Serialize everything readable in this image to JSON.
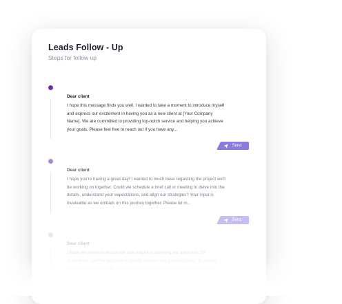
{
  "header": {
    "title": "Leads Follow - Up",
    "subtitle": "Steps for follow up"
  },
  "steps": [
    {
      "greeting": "Dear client",
      "body": "I hope this message finds you well. I wanted to take a moment to introduce myself and express our excitement in having you as a new client at [Your Company Name]. We are committed to providing top-notch service and helping you achieve your goals. Please feel free to reach out if you have any...",
      "send_label": "Send",
      "dot_color": "#6a2fa5",
      "button_color": "#8d7adf"
    },
    {
      "greeting": "Dear client",
      "body": "I hope you're having a great day! I wanted to touch base regarding the project we'll be working on together. Could we schedule a brief call or meeting to delve into the details, understand your expectations, and align our strategies? Your input is invaluable as we embark on this journey together. Please let m...",
      "send_label": "Send",
      "dot_color": "#a78ad0",
      "button_color": "#c7bdf0"
    },
    {
      "greeting": "Dear client",
      "body": "I hope our previous discussion was helpful in clarifying our approach. To summarize, we'll be focusing on [briefly mention key project points]. To ensure we're on the same page, I've attached a detailed project plan for your review.",
      "dot_color": "#d4d4e6"
    }
  ],
  "icons": {
    "send": "send-icon"
  }
}
